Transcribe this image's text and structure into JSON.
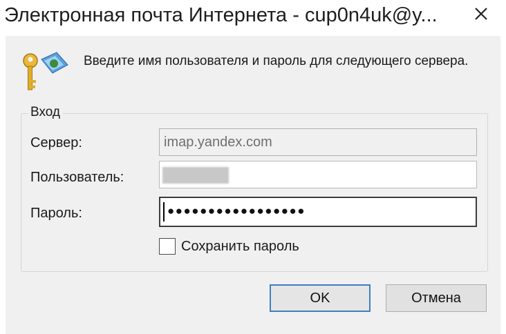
{
  "window": {
    "title": "Электронная почта Интернета - cup0n4uk@y..."
  },
  "dialog": {
    "prompt": "Введите имя пользователя и пароль для следующего сервера.",
    "group_title": "Вход",
    "server_label": "Сервер:",
    "server_value": "imap.yandex.com",
    "user_label": "Пользователь:",
    "user_value": "",
    "password_label": "Пароль:",
    "password_mask": "●●●●●●●●●●●●●●●●●",
    "remember_label": "Сохранить пароль",
    "remember_checked": false,
    "ok_label": "OK",
    "cancel_label": "Отмена"
  },
  "icons": {
    "close": "close-icon",
    "keys": "keys-icon"
  },
  "colors": {
    "default_button_border": "#3d7fbf",
    "dialog_background": "#f0f0f0"
  }
}
